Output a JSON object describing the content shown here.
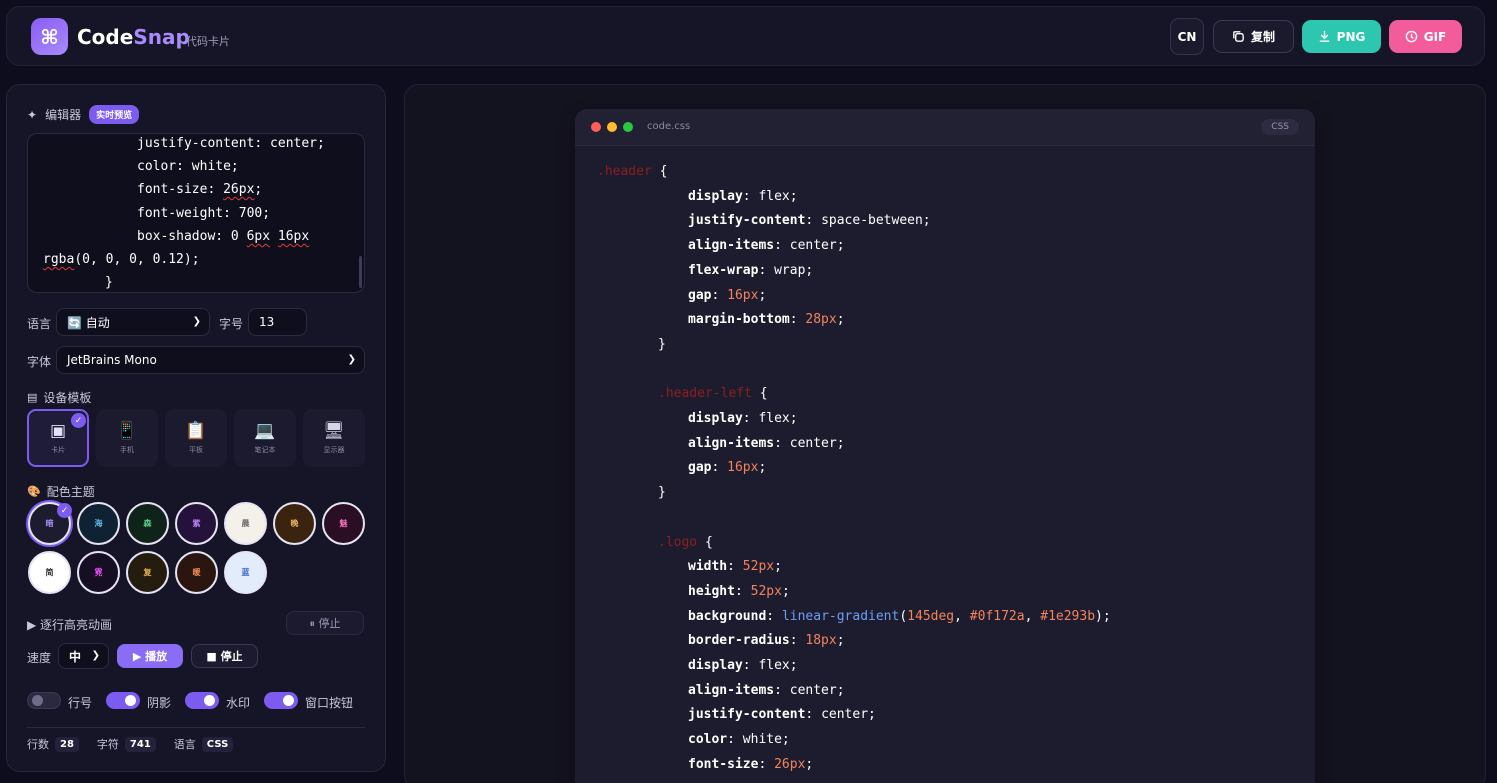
{
  "header": {
    "logo_glyph": "⌘",
    "brand_a": "Code",
    "brand_b": "Snap",
    "tagline": "· 代码卡片",
    "lang_btn": "CN",
    "copy_btn": "复制",
    "png_btn": "PNG",
    "gif_btn": "GIF"
  },
  "editor": {
    "title": "编辑器",
    "badge": "实时预览",
    "lines": [
      "justify-content: center;",
      "color: white;",
      "font-size: ",
      "26px",
      ";",
      "font-weight: 700;",
      "box-shadow: 0 ",
      "6px",
      " ",
      "16px",
      "rgba",
      "(0, 0, 0, 0.12);",
      "}"
    ]
  },
  "settings": {
    "language_label": "语言",
    "language_value": "🔄 自动",
    "fontsize_label": "字号",
    "fontsize_value": "13",
    "font_label": "字体",
    "font_value": "JetBrains Mono"
  },
  "devices": {
    "title": "设备模板",
    "items": [
      {
        "label": "卡片",
        "icon": "▣"
      },
      {
        "label": "手机",
        "icon": "📱"
      },
      {
        "label": "平板",
        "icon": "📋"
      },
      {
        "label": "笔记本",
        "icon": "💻"
      },
      {
        "label": "显示器",
        "icon": "🖥"
      }
    ]
  },
  "themes": {
    "title": "配色主题",
    "items": [
      {
        "label": "暗",
        "bg": "#1d1c2e",
        "fg": "#a78bfa"
      },
      {
        "label": "海",
        "bg": "#0f2233",
        "fg": "#5fb8e8"
      },
      {
        "label": "森",
        "bg": "#10231a",
        "fg": "#5fd08a"
      },
      {
        "label": "紫",
        "bg": "#24123a",
        "fg": "#c084fc"
      },
      {
        "label": "晨",
        "bg": "#f3f1ea",
        "fg": "#6b6b6b"
      },
      {
        "label": "晚",
        "bg": "#3a2410",
        "fg": "#f2b866"
      },
      {
        "label": "魅",
        "bg": "#2a0f24",
        "fg": "#f472b6"
      },
      {
        "label": "简",
        "bg": "#ffffff",
        "fg": "#333333"
      },
      {
        "label": "霓",
        "bg": "#160f24",
        "fg": "#e14be8"
      },
      {
        "label": "复",
        "bg": "#241c0f",
        "fg": "#e0b15a"
      },
      {
        "label": "暖",
        "bg": "#2a160f",
        "fg": "#f08a5d"
      },
      {
        "label": "蓝",
        "bg": "#e3ecfb",
        "fg": "#3a66c4"
      }
    ]
  },
  "animation": {
    "title": "▶ 逐行高亮动画",
    "stop_small": "⏸ 停止",
    "speed_label": "速度",
    "speed_value": "中",
    "play_btn": "▶ 播放",
    "stop_btn": "■ 停止"
  },
  "toggles": [
    {
      "label": "行号",
      "on": false
    },
    {
      "label": "阴影",
      "on": true
    },
    {
      "label": "水印",
      "on": true
    },
    {
      "label": "窗口按钮",
      "on": true
    }
  ],
  "stats": {
    "lines_label": "行数",
    "lines_value": "28",
    "chars_label": "字符",
    "chars_value": "741",
    "lang_label": "语言",
    "lang_value": "CSS"
  },
  "preview": {
    "filename": "code.css",
    "lang_tag": "CSS",
    "code": [
      {
        "t": "sel",
        "text": ".header",
        "rest": " {"
      },
      {
        "p": "display",
        "v": "flex;"
      },
      {
        "p": "justify-content",
        "v": "space-between;"
      },
      {
        "p": "align-items",
        "v": "center;"
      },
      {
        "p": "flex-wrap",
        "v": "wrap;"
      },
      {
        "p": "gap",
        "n": "16px",
        "v": ";"
      },
      {
        "p": "margin-bottom",
        "n": "28px",
        "v": ";"
      },
      {
        "t": "close",
        "text": "}"
      },
      {
        "t": "blank"
      },
      {
        "t": "sel",
        "text": ".header-left",
        "rest": " {"
      },
      {
        "p": "display",
        "v": "flex;"
      },
      {
        "p": "align-items",
        "v": "center;"
      },
      {
        "p": "gap",
        "n": "16px",
        "v": ";"
      },
      {
        "t": "close",
        "text": "}"
      },
      {
        "t": "blank"
      },
      {
        "t": "sel",
        "text": ".logo",
        "rest": " {"
      },
      {
        "p": "width",
        "n": "52px",
        "v": ";"
      },
      {
        "p": "height",
        "n": "52px",
        "v": ";"
      },
      {
        "p": "background",
        "fn": "linear-gradient",
        "args": [
          "145deg",
          "#0f172a",
          "#1e293b"
        ]
      },
      {
        "p": "border-radius",
        "n": "18px",
        "v": ";"
      },
      {
        "p": "display",
        "v": "flex;"
      },
      {
        "p": "align-items",
        "v": "center;"
      },
      {
        "p": "justify-content",
        "v": "center;"
      },
      {
        "p": "color",
        "v": "white;"
      },
      {
        "p": "font-size",
        "n": "26px",
        "v": ";"
      }
    ]
  },
  "colors": {
    "accent": "#7c5cf0",
    "png": "#2dc7b0",
    "gif": "#f25c9b"
  }
}
